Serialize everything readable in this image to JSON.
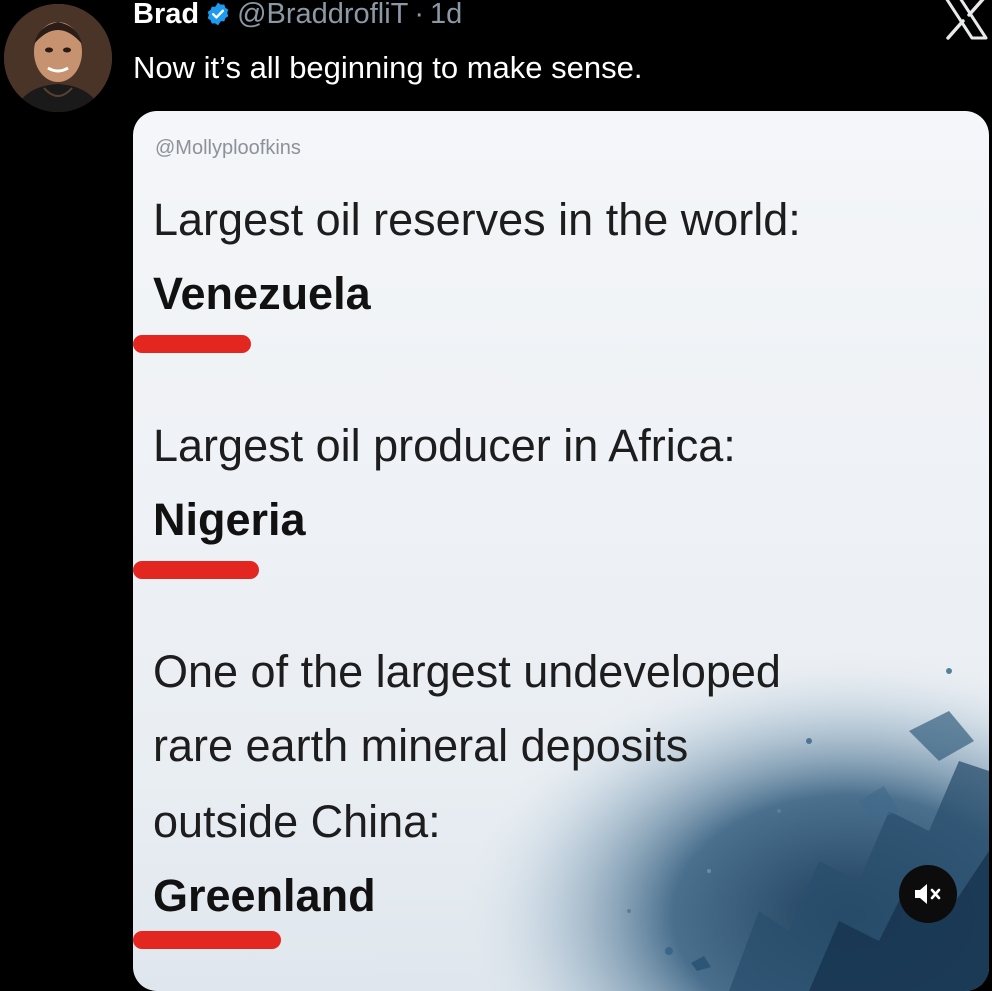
{
  "tweet": {
    "author_name": "Brad",
    "author_handle": "@BraddrofliT",
    "separator": "·",
    "time": "1d",
    "text": "Now it’s all beginning to make sense."
  },
  "media": {
    "watermark": "@Mollyploofkins",
    "lines": [
      "Largest oil reserves in the world:",
      "Venezuela",
      "Largest oil producer in Africa:",
      "Nigeria",
      "One of the largest undeveloped",
      "rare earth mineral deposits",
      "outside China:",
      "Greenland"
    ]
  },
  "icons": {
    "verified": "verified-badge-icon",
    "logo": "x-logo-icon",
    "mute": "volume-muted-icon"
  },
  "colors": {
    "background": "#000000",
    "verified": "#1d9bf0",
    "underline": "#e3261f",
    "muted_text": "#8b98a5"
  }
}
